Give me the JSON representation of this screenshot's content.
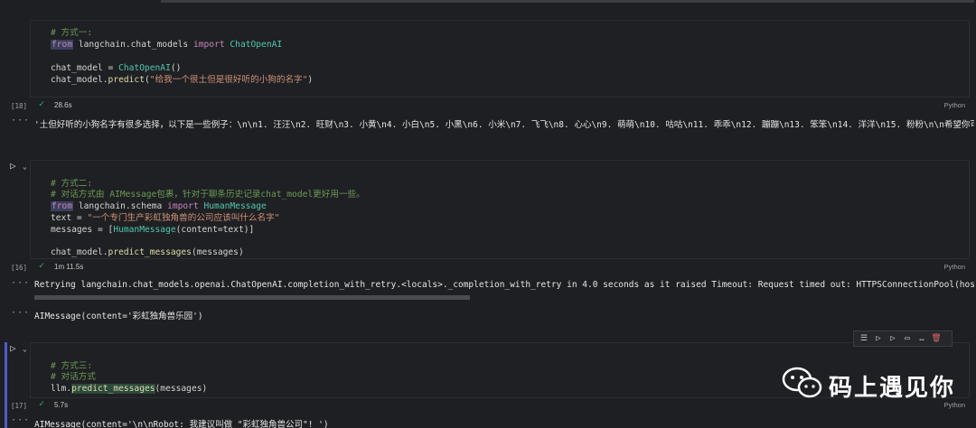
{
  "cells": [
    {
      "exec_count": "[18]",
      "code": {
        "comment": "# 方式一:",
        "line1": [
          "from",
          " langchain.chat_models ",
          "import",
          " ChatOpenAI"
        ],
        "line3": [
          "chat_model",
          " = ",
          "ChatOpenAI",
          "()"
        ],
        "line4": [
          "chat_model.",
          "predict",
          "(",
          "\"给我一个很土但是很好听的小狗的名字\"",
          ")"
        ]
      },
      "status_time": "28.6s",
      "language": "Python",
      "output": "'土但好听的小狗名字有很多选择，以下是一些例子：\\n\\n1. 汪汪\\n2. 旺财\\n3. 小黄\\n4. 小白\\n5. 小黑\\n6. 小米\\n7. 飞飞\\n8. 心心\\n9. 萌萌\\n10. 咕咕\\n11. 乖乖\\n12. 蹦蹦\\n13. 笨笨\\n14. 洋洋\\n15. 粉粉\\n\\n希望你可以从中找到"
    },
    {
      "exec_count": "[16]",
      "code": {
        "comment1": "# 方式二:",
        "comment2": "# 对话方式由 AIMessage包裹，针对于聊条历史记录chat_model更好用一些。",
        "line1": [
          "from",
          " langchain.schema ",
          "import",
          " HumanMessage"
        ],
        "line2": [
          "text",
          " = ",
          "\"一个专门生产彩虹独角兽的公司应该叫什么名字\""
        ],
        "line3": [
          "messages",
          " = ",
          "[",
          "HumanMessage",
          "(content=text)]"
        ],
        "line5": [
          "chat_model.",
          "predict_messages",
          "(messages)"
        ]
      },
      "status_time": "1m 11.5s",
      "language": "Python",
      "output_retry": "Retrying langchain.chat_models.openai.ChatOpenAI.completion_with_retry.<locals>._completion_with_retry in 4.0 seconds as it raised Timeout: Request timed out: HTTPSConnectionPool(host='api.openai.com',",
      "output_result": "AIMessage(content='彩虹独角兽乐园')"
    },
    {
      "exec_count": "[17]",
      "code": {
        "comment1": "# 方式三:",
        "comment2": "# 对话方式",
        "line1": [
          "llm.",
          "predict_messages",
          "(messages)"
        ]
      },
      "status_time": "5.7s",
      "language": "Python",
      "output": "AIMessage(content='\\n\\nRobot: 我建议叫做 \"彩虹独角兽公司\"! ')"
    }
  ],
  "icons": {
    "run": "run-icon",
    "check": "check-icon",
    "more": "ellipsis-icon"
  },
  "watermark": {
    "text": "码上遇见你"
  },
  "colors": {
    "background": "#1e1f22",
    "check": "#35b36a",
    "selected_bar": "#4d5ec9"
  }
}
